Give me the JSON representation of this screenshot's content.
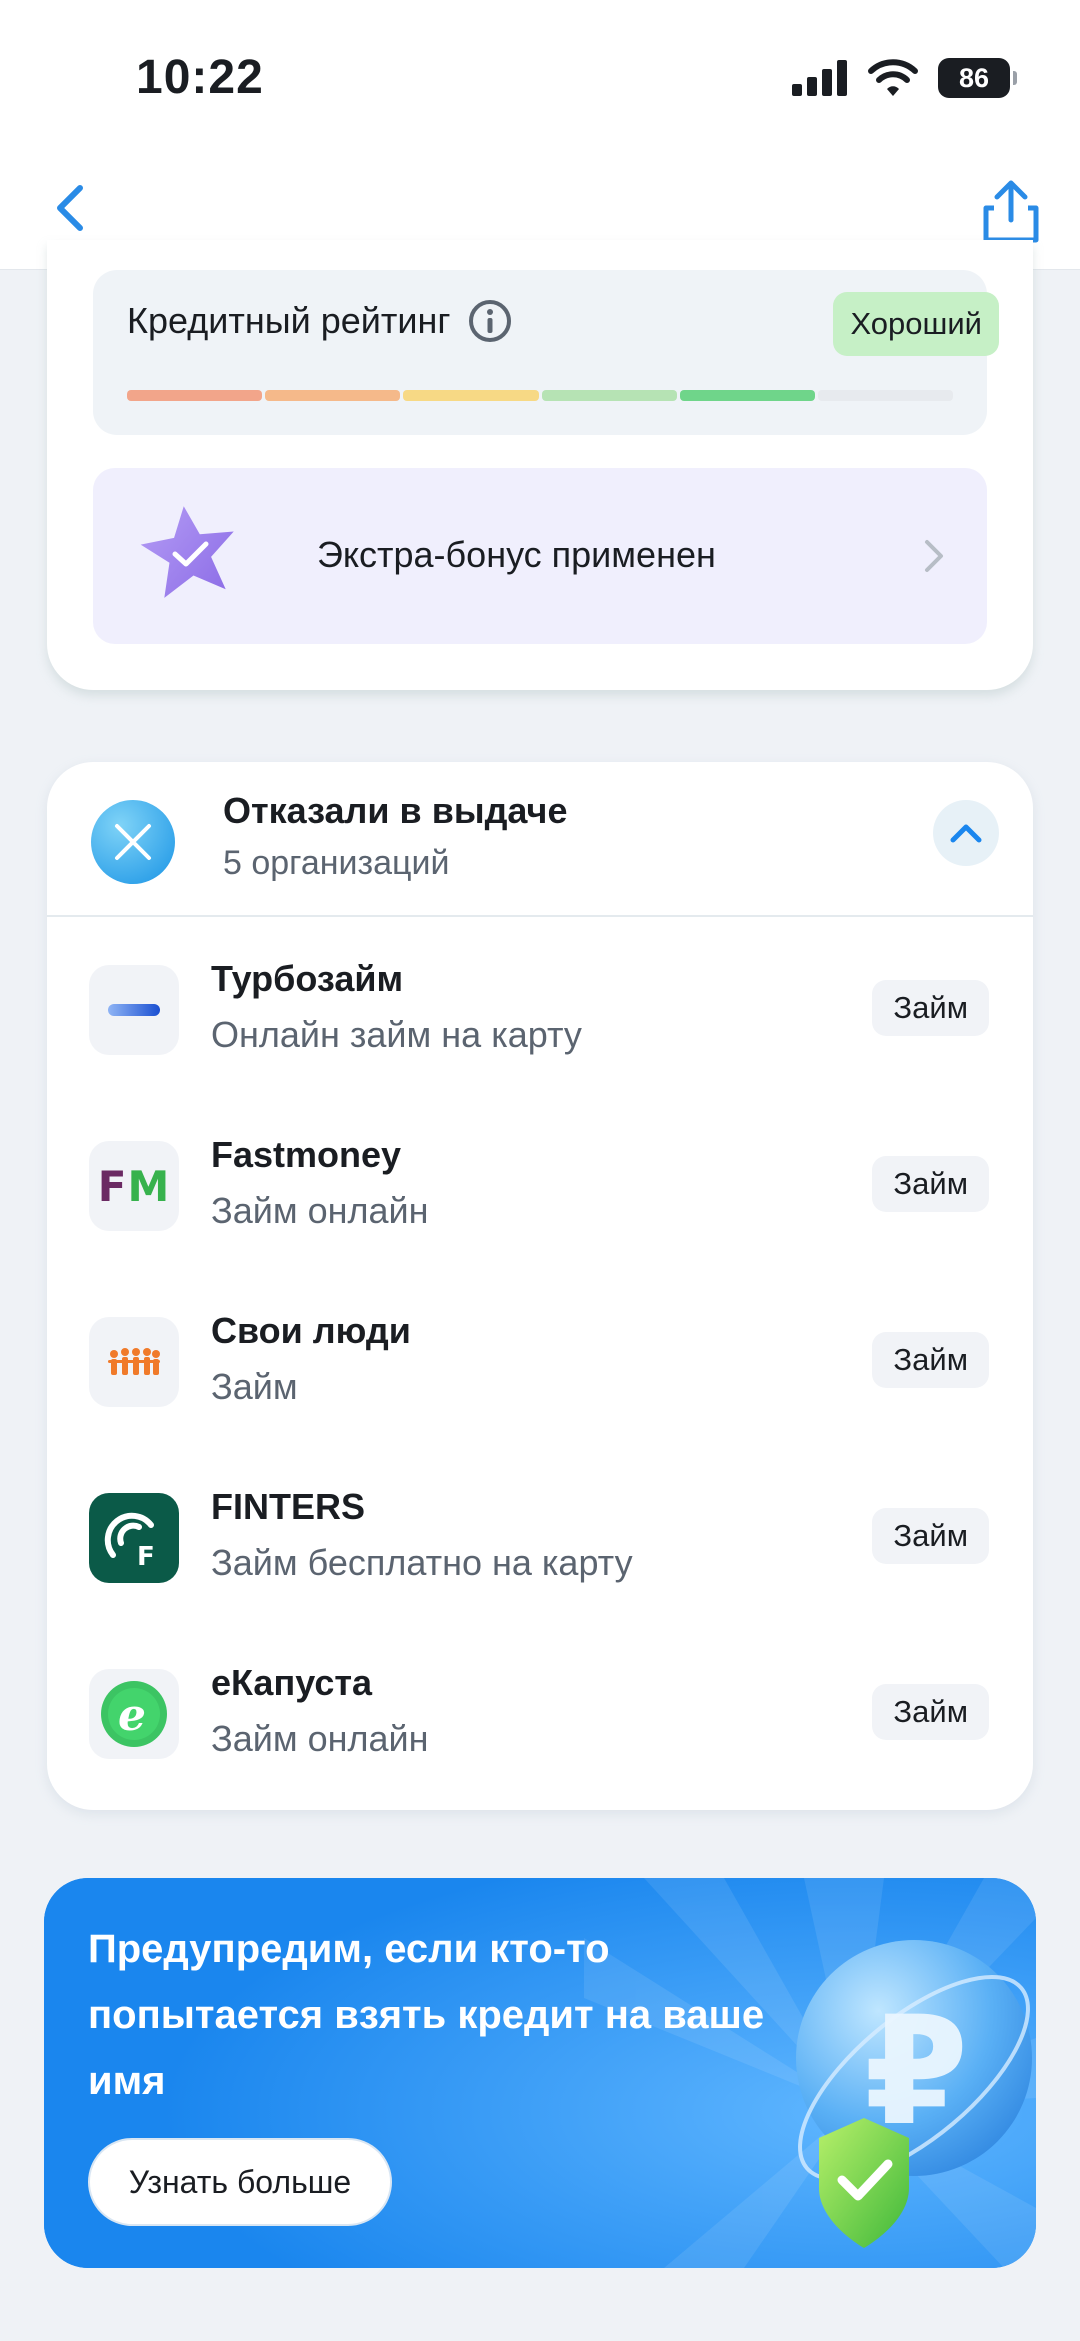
{
  "status_bar": {
    "time": "10:22",
    "battery": "86"
  },
  "nav": {
    "back_icon": "chevron-left-icon",
    "share_icon": "share-icon"
  },
  "credit_rating": {
    "label": "Кредитный рейтинг",
    "status": "Хороший",
    "segments": [
      "#f2a58a",
      "#f5b98a",
      "#f7d985",
      "#b6e3b4",
      "#6fd58a",
      "#e7eaee"
    ]
  },
  "bonus": {
    "label": "Экстра-бонус применен"
  },
  "refused": {
    "title": "Отказали в выдаче",
    "subtitle": "5 организаций",
    "lenders": [
      {
        "name": "Турбозайм",
        "desc": "Онлайн займ на карту",
        "tag": "Займ",
        "logo": "turbozaim-logo"
      },
      {
        "name": "Fastmoney",
        "desc": "Займ онлайн",
        "tag": "Займ",
        "logo": "fastmoney-logo",
        "logo_text": "FM"
      },
      {
        "name": "Свои люди",
        "desc": "Займ",
        "tag": "Займ",
        "logo": "svoi-lyudi-logo"
      },
      {
        "name": "FINTERS",
        "desc": "Займ бесплатно на карту",
        "tag": "Займ",
        "logo": "finters-logo"
      },
      {
        "name": "еКапуста",
        "desc": "Займ онлайн",
        "tag": "Займ",
        "logo": "ekapusta-logo"
      }
    ]
  },
  "promo": {
    "text": "Предупредим, если кто-то попытается взять кредит на ваше имя",
    "button": "Узнать больше"
  }
}
